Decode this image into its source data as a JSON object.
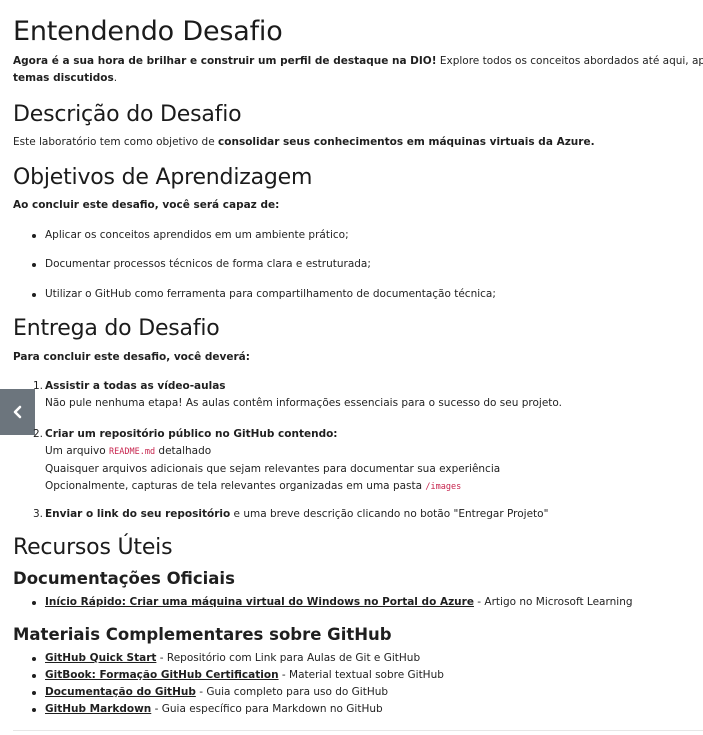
{
  "main_title": "Entendendo Desafio",
  "intro": {
    "bold": "Agora é a sua hora de brilhar e construir um perfil de destaque na DIO!",
    "text": " Explore todos os conceitos abordados até aqui, aplique os conh",
    "bold2": "temas discutidos",
    "end": "."
  },
  "descricao": {
    "title": "Descrição do Desafio",
    "text": "Este laboratório tem como objetivo de ",
    "bold": "consolidar seus conhecimentos em máquinas virtuais da Azure."
  },
  "objetivos": {
    "title": "Objetivos de Aprendizagem",
    "lead": "Ao concluir este desafio, você será capaz de:",
    "items": [
      "Aplicar os conceitos aprendidos em um ambiente prático;",
      "Documentar processos técnicos de forma clara e estruturada;",
      "Utilizar o GitHub como ferramenta para compartilhamento de documentação técnica;"
    ]
  },
  "entrega": {
    "title": "Entrega do Desafio",
    "lead": "Para concluir este desafio, você deverá:",
    "step1": {
      "num": "1.",
      "bold": "Assistir a todas as vídeo-aulas",
      "line": "Não pule nenhuma etapa! As aulas contêm informações essenciais para o sucesso do seu projeto."
    },
    "step2": {
      "num": "2.",
      "bold": "Criar um repositório público no GitHub contendo:",
      "line1_a": "Um arquivo ",
      "line1_code": "README.md",
      "line1_b": " detalhado",
      "line2": "Quaisquer arquivos adicionais que sejam relevantes para documentar sua experiência",
      "line3_a": "Opcionalmente, capturas de tela relevantes organizadas em uma pasta ",
      "line3_code": "/images"
    },
    "step3": {
      "num": "3.",
      "bold": "Enviar o link do seu repositório",
      "text": " e uma breve descrição clicando no botão \"Entregar Projeto\""
    }
  },
  "recursos": {
    "title": "Recursos Úteis",
    "docs_title": "Documentações Oficiais",
    "docs": [
      {
        "link": "Início Rápido: Criar uma máquina virtual do Windows no Portal do Azure",
        "desc": " - Artigo no Microsoft Learning"
      }
    ],
    "github_title": "Materiais Complementares sobre GitHub",
    "github": [
      {
        "link": "GitHub Quick Start",
        "desc": " - Repositório com Link para Aulas de Git e GitHub"
      },
      {
        "link": "GitBook: Formação GitHub Certification",
        "desc": " - Material textual sobre GitHub"
      },
      {
        "link": "Documentação do GitHub",
        "desc": " - Guia completo para uso do GitHub"
      },
      {
        "link": "GitHub Markdown",
        "desc": " - Guia específico para Markdown no GitHub"
      }
    ]
  },
  "icons": {
    "side_button": "chevron-left-icon"
  },
  "colors": {
    "side_button_bg": "#6c757d",
    "code": "#c7254e"
  }
}
